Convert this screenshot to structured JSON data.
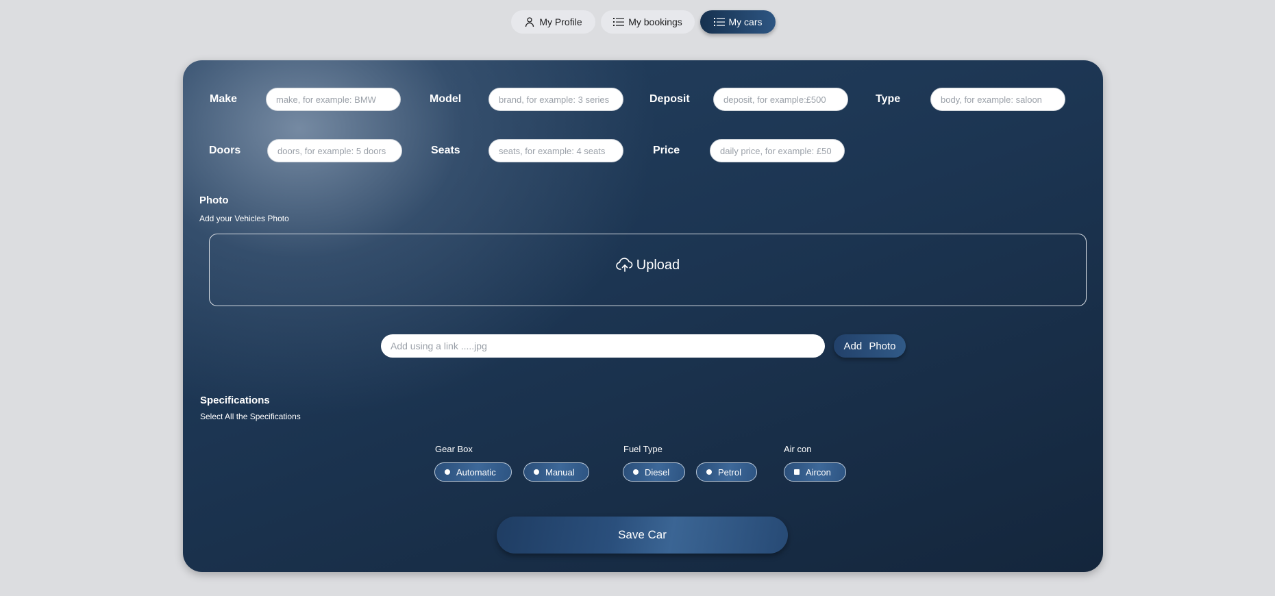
{
  "nav": {
    "profile": {
      "label": "My Profile",
      "icon": "user-icon"
    },
    "bookings": {
      "label": "My bookings",
      "icon": "list-icon"
    },
    "cars": {
      "label": "My cars",
      "icon": "list-icon",
      "active": true
    }
  },
  "form": {
    "make": {
      "label": "Make",
      "placeholder": "make, for example: BMW",
      "value": ""
    },
    "model": {
      "label": "Model",
      "placeholder": "brand, for example: 3 series",
      "value": ""
    },
    "deposit": {
      "label": "Deposit",
      "placeholder": "deposit, for example:£500",
      "value": ""
    },
    "type": {
      "label": "Type",
      "placeholder": "body, for example: saloon",
      "value": ""
    },
    "doors": {
      "label": "Doors",
      "placeholder": "doors, for example: 5 doors",
      "value": ""
    },
    "seats": {
      "label": "Seats",
      "placeholder": "seats, for example: 4 seats",
      "value": ""
    },
    "price": {
      "label": "Price",
      "placeholder": "daily price, for example: £50",
      "value": ""
    }
  },
  "photo": {
    "title": "Photo",
    "subtitle": "Add your Vehicles Photo",
    "upload_label": "Upload",
    "upload_icon": "cloud-upload-icon",
    "link_placeholder": "Add using a link .....jpg",
    "add_button": "Add Photo"
  },
  "specs": {
    "title": "Specifications",
    "subtitle": "Select All the Specifications",
    "gearbox": {
      "label": "Gear Box",
      "options": [
        "Automatic",
        "Manual"
      ]
    },
    "fuel": {
      "label": "Fuel Type",
      "options": [
        "Diesel",
        "Petrol"
      ]
    },
    "aircon": {
      "label": "Air con",
      "options": [
        "Aircon"
      ]
    }
  },
  "save_button": "Save Car",
  "colors": {
    "page_bg": "#dcdde0",
    "card_dark": "#14263c",
    "accent": "#2d5582"
  }
}
